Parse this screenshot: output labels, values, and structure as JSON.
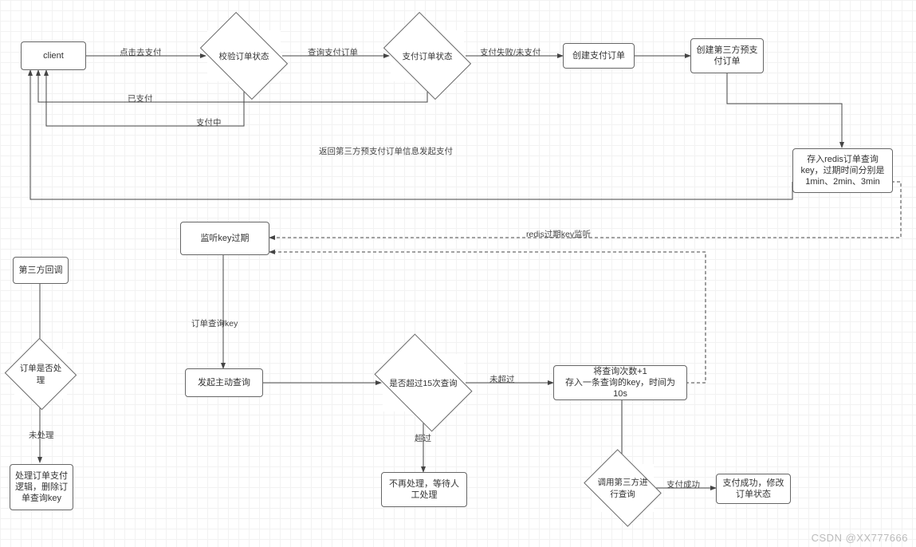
{
  "nodes": {
    "client": "client",
    "verify_order_status": "校验订单状态",
    "pay_order_status": "支付订单状态",
    "create_pay_order": "创建支付订单",
    "create_third_prepay": "创建第三方预支付订单",
    "save_redis": "存入redis订单查询key，过期时间分别是1min、2min、3min",
    "listen_key_expired": "监听key过期",
    "third_callback": "第三方回调",
    "order_processed": "订单是否处理",
    "process_logic": "处理订单支付逻辑，删除订单查询key",
    "active_query": "发起主动查询",
    "over_15": "是否超过15次查询",
    "nomore": "不再处理，等待人工处理",
    "plus_one": "将查询次数+1\n存入一条查询的key，时间为10s",
    "call_third_query": "调用第三方进行查询",
    "pay_success": "支付成功，修改订单状态"
  },
  "edges": {
    "click_pay": "点击去支付",
    "query_pay_order": "查询支付订单",
    "pay_failed": "支付失败/未支付",
    "already_paid": "已支付",
    "paying": "支付中",
    "return_third_prepay": "返回第三方预支付订单信息发起支付",
    "redis_expire_listen": "redis过期key监听",
    "order_query_key": "订单查询key",
    "unprocessed": "未处理",
    "not_over": "未超过",
    "over": "超过",
    "pay_succ_label": "支付成功"
  },
  "watermark": "CSDN @XX777666"
}
